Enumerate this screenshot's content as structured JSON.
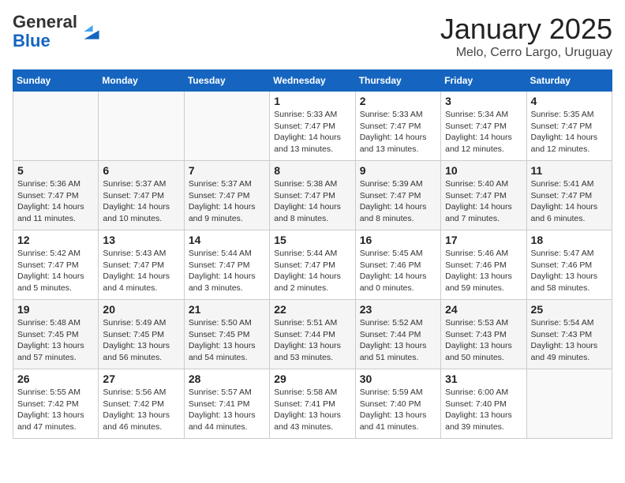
{
  "header": {
    "logo_general": "General",
    "logo_blue": "Blue",
    "title": "January 2025",
    "subtitle": "Melo, Cerro Largo, Uruguay"
  },
  "weekdays": [
    "Sunday",
    "Monday",
    "Tuesday",
    "Wednesday",
    "Thursday",
    "Friday",
    "Saturday"
  ],
  "weeks": [
    [
      {
        "day": "",
        "info": ""
      },
      {
        "day": "",
        "info": ""
      },
      {
        "day": "",
        "info": ""
      },
      {
        "day": "1",
        "info": "Sunrise: 5:33 AM\nSunset: 7:47 PM\nDaylight: 14 hours\nand 13 minutes."
      },
      {
        "day": "2",
        "info": "Sunrise: 5:33 AM\nSunset: 7:47 PM\nDaylight: 14 hours\nand 13 minutes."
      },
      {
        "day": "3",
        "info": "Sunrise: 5:34 AM\nSunset: 7:47 PM\nDaylight: 14 hours\nand 12 minutes."
      },
      {
        "day": "4",
        "info": "Sunrise: 5:35 AM\nSunset: 7:47 PM\nDaylight: 14 hours\nand 12 minutes."
      }
    ],
    [
      {
        "day": "5",
        "info": "Sunrise: 5:36 AM\nSunset: 7:47 PM\nDaylight: 14 hours\nand 11 minutes."
      },
      {
        "day": "6",
        "info": "Sunrise: 5:37 AM\nSunset: 7:47 PM\nDaylight: 14 hours\nand 10 minutes."
      },
      {
        "day": "7",
        "info": "Sunrise: 5:37 AM\nSunset: 7:47 PM\nDaylight: 14 hours\nand 9 minutes."
      },
      {
        "day": "8",
        "info": "Sunrise: 5:38 AM\nSunset: 7:47 PM\nDaylight: 14 hours\nand 8 minutes."
      },
      {
        "day": "9",
        "info": "Sunrise: 5:39 AM\nSunset: 7:47 PM\nDaylight: 14 hours\nand 8 minutes."
      },
      {
        "day": "10",
        "info": "Sunrise: 5:40 AM\nSunset: 7:47 PM\nDaylight: 14 hours\nand 7 minutes."
      },
      {
        "day": "11",
        "info": "Sunrise: 5:41 AM\nSunset: 7:47 PM\nDaylight: 14 hours\nand 6 minutes."
      }
    ],
    [
      {
        "day": "12",
        "info": "Sunrise: 5:42 AM\nSunset: 7:47 PM\nDaylight: 14 hours\nand 5 minutes."
      },
      {
        "day": "13",
        "info": "Sunrise: 5:43 AM\nSunset: 7:47 PM\nDaylight: 14 hours\nand 4 minutes."
      },
      {
        "day": "14",
        "info": "Sunrise: 5:44 AM\nSunset: 7:47 PM\nDaylight: 14 hours\nand 3 minutes."
      },
      {
        "day": "15",
        "info": "Sunrise: 5:44 AM\nSunset: 7:47 PM\nDaylight: 14 hours\nand 2 minutes."
      },
      {
        "day": "16",
        "info": "Sunrise: 5:45 AM\nSunset: 7:46 PM\nDaylight: 14 hours\nand 0 minutes."
      },
      {
        "day": "17",
        "info": "Sunrise: 5:46 AM\nSunset: 7:46 PM\nDaylight: 13 hours\nand 59 minutes."
      },
      {
        "day": "18",
        "info": "Sunrise: 5:47 AM\nSunset: 7:46 PM\nDaylight: 13 hours\nand 58 minutes."
      }
    ],
    [
      {
        "day": "19",
        "info": "Sunrise: 5:48 AM\nSunset: 7:45 PM\nDaylight: 13 hours\nand 57 minutes."
      },
      {
        "day": "20",
        "info": "Sunrise: 5:49 AM\nSunset: 7:45 PM\nDaylight: 13 hours\nand 56 minutes."
      },
      {
        "day": "21",
        "info": "Sunrise: 5:50 AM\nSunset: 7:45 PM\nDaylight: 13 hours\nand 54 minutes."
      },
      {
        "day": "22",
        "info": "Sunrise: 5:51 AM\nSunset: 7:44 PM\nDaylight: 13 hours\nand 53 minutes."
      },
      {
        "day": "23",
        "info": "Sunrise: 5:52 AM\nSunset: 7:44 PM\nDaylight: 13 hours\nand 51 minutes."
      },
      {
        "day": "24",
        "info": "Sunrise: 5:53 AM\nSunset: 7:43 PM\nDaylight: 13 hours\nand 50 minutes."
      },
      {
        "day": "25",
        "info": "Sunrise: 5:54 AM\nSunset: 7:43 PM\nDaylight: 13 hours\nand 49 minutes."
      }
    ],
    [
      {
        "day": "26",
        "info": "Sunrise: 5:55 AM\nSunset: 7:42 PM\nDaylight: 13 hours\nand 47 minutes."
      },
      {
        "day": "27",
        "info": "Sunrise: 5:56 AM\nSunset: 7:42 PM\nDaylight: 13 hours\nand 46 minutes."
      },
      {
        "day": "28",
        "info": "Sunrise: 5:57 AM\nSunset: 7:41 PM\nDaylight: 13 hours\nand 44 minutes."
      },
      {
        "day": "29",
        "info": "Sunrise: 5:58 AM\nSunset: 7:41 PM\nDaylight: 13 hours\nand 43 minutes."
      },
      {
        "day": "30",
        "info": "Sunrise: 5:59 AM\nSunset: 7:40 PM\nDaylight: 13 hours\nand 41 minutes."
      },
      {
        "day": "31",
        "info": "Sunrise: 6:00 AM\nSunset: 7:40 PM\nDaylight: 13 hours\nand 39 minutes."
      },
      {
        "day": "",
        "info": ""
      }
    ]
  ]
}
